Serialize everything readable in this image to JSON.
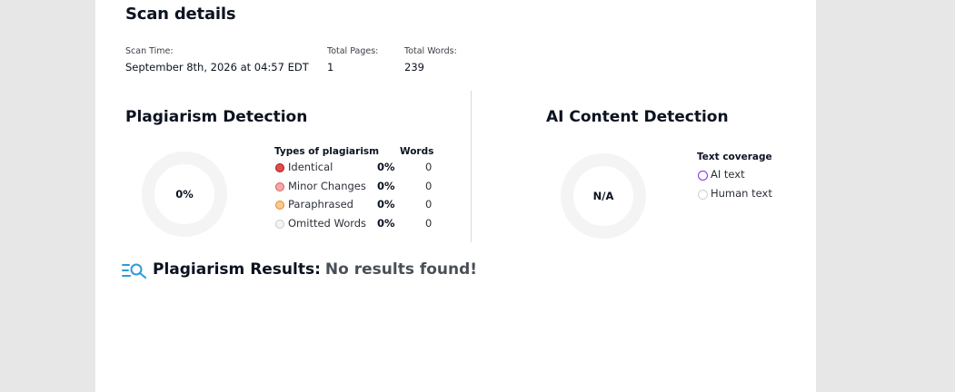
{
  "scan": {
    "title": "Scan details",
    "scan_time_label": "Scan Time:",
    "scan_time_value": "September 8th, 2026 at 04:57 EDT",
    "pages_label": "Total Pages:",
    "pages_value": "1",
    "words_label": "Total Words:",
    "words_value": "239"
  },
  "plagiarism": {
    "title": "Plagiarism Detection",
    "donut_value": "0%",
    "types_header": "Types of plagiarism",
    "words_header": "Words",
    "rows": [
      {
        "name": "Identical",
        "percent": "0%",
        "words": "0",
        "fill": "#e84a4a",
        "stroke": "#9c1c1c"
      },
      {
        "name": "Minor Changes",
        "percent": "0%",
        "words": "0",
        "fill": "#f7a7a7",
        "stroke": "#d25f5f"
      },
      {
        "name": "Paraphrased",
        "percent": "0%",
        "words": "0",
        "fill": "#fbc98a",
        "stroke": "#e08a2a"
      },
      {
        "name": "Omitted Words",
        "percent": "0%",
        "words": "0",
        "fill": "#f5f5f5",
        "stroke": "#c9c9c9"
      }
    ]
  },
  "ai": {
    "title": "AI Content Detection",
    "donut_value": "N/A",
    "coverage_header": "Text coverage",
    "items": [
      {
        "name": "AI text",
        "color": "#7b2ff2"
      },
      {
        "name": "Human text",
        "color": "#cfcfcf"
      }
    ]
  },
  "results": {
    "label": "Plagiarism Results:",
    "status": "No results found!",
    "icon": "search-results-icon",
    "icon_color": "#2f9bd6"
  }
}
